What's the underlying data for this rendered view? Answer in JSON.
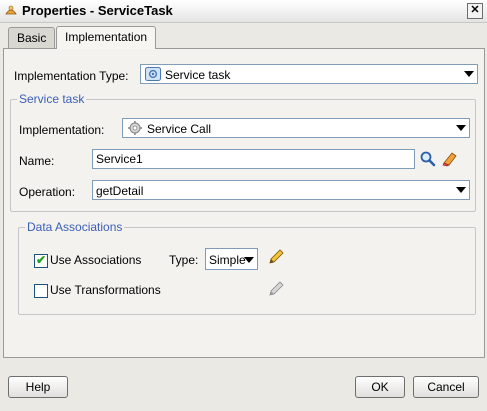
{
  "window": {
    "title": "Properties - ServiceTask",
    "close_glyph": "✕"
  },
  "tabs": [
    {
      "label": "Basic"
    },
    {
      "label": "Implementation"
    }
  ],
  "implementation_type": {
    "label": "Implementation Type:",
    "value": "Service task",
    "icon": "service-task-icon"
  },
  "service_task_group": {
    "title": "Service task",
    "implementation": {
      "label": "Implementation:",
      "value": "Service Call",
      "icon": "gear-icon"
    },
    "name": {
      "label": "Name:",
      "value": "Service1"
    },
    "operation": {
      "label": "Operation:",
      "value": "getDetail"
    }
  },
  "data_associations_group": {
    "title": "Data Associations",
    "use_associations": {
      "label": "Use Associations",
      "checked": true
    },
    "type": {
      "label": "Type:",
      "value": "Simple"
    },
    "use_transformations": {
      "label": "Use Transformations",
      "checked": false
    }
  },
  "footer": {
    "help": "Help",
    "ok": "OK",
    "cancel": "Cancel"
  }
}
